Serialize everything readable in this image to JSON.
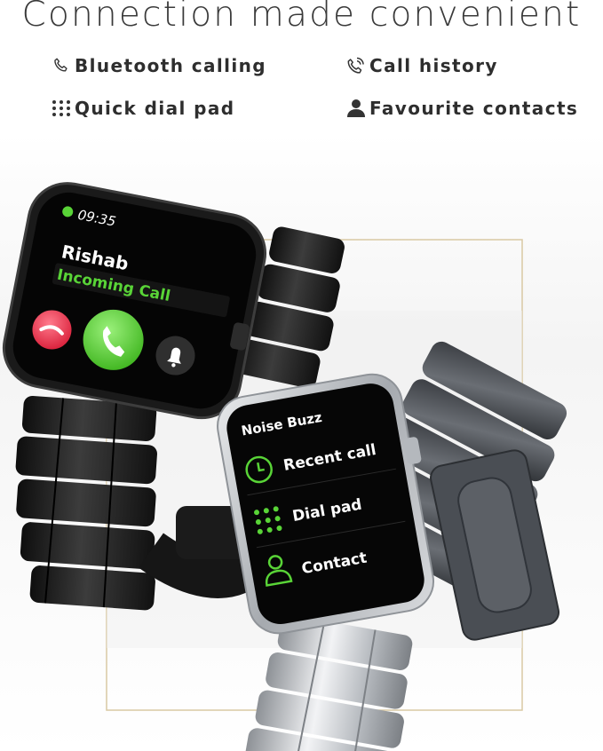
{
  "headline": "Connection made convenient",
  "features": [
    {
      "icon": "phone-icon",
      "label": "Bluetooth calling"
    },
    {
      "icon": "call-history-icon",
      "label": "Call history"
    },
    {
      "icon": "dial-pad-icon",
      "label": "Quick dial pad"
    },
    {
      "icon": "person-icon",
      "label": "Favourite contacts"
    }
  ],
  "black_watch": {
    "time": "09:35",
    "caller": "Rishab",
    "status": "Incoming Call",
    "buttons": [
      "decline-call-icon",
      "accept-call-icon",
      "bell-icon"
    ]
  },
  "silver_watch": {
    "header": "Noise Buzz",
    "menu": [
      {
        "icon": "clock-icon",
        "label": "Recent call"
      },
      {
        "icon": "dial-pad-icon",
        "label": "Dial pad"
      },
      {
        "icon": "contact-icon",
        "label": "Contact"
      }
    ]
  },
  "colors": {
    "accent_green": "#59d437",
    "decline_red": "#e8344a",
    "silver": "#c9ccd0",
    "black_case": "#1a1a1a",
    "frame_gold": "#d9c9a3"
  }
}
